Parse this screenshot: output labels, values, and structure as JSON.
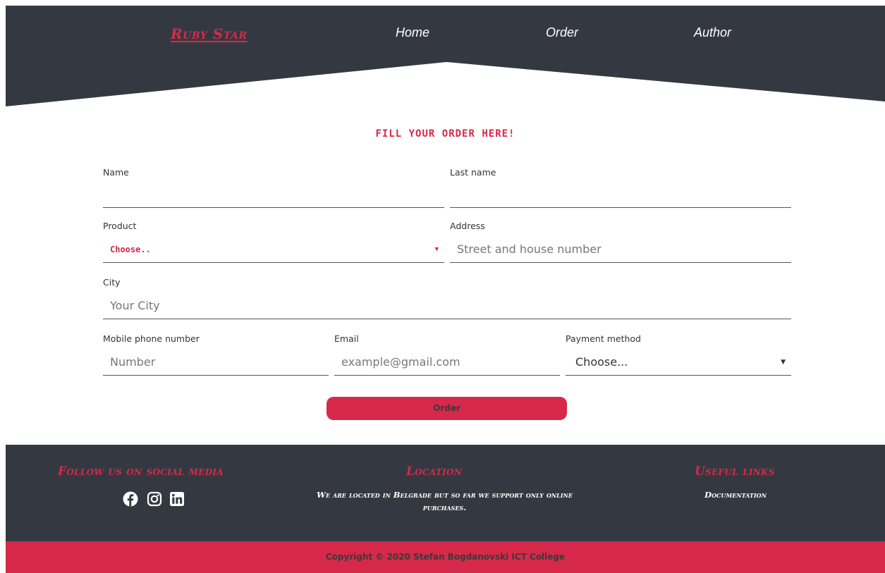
{
  "header": {
    "logo": "Ruby Star",
    "nav": {
      "home": "Home",
      "order": "Order",
      "author": "Author"
    }
  },
  "form": {
    "title": "Fill your order here!",
    "name_label": "Name",
    "last_name_label": "Last name",
    "product_label": "Product",
    "product_selected": "Choose..",
    "address_label": "Address",
    "address_placeholder": "Street and house number",
    "city_label": "City",
    "city_placeholder": "Your City",
    "phone_label": "Mobile phone number",
    "phone_placeholder": "Number",
    "email_label": "Email",
    "email_placeholder": "example@gmail.com",
    "payment_label": "Payment method",
    "payment_selected": "Choose...",
    "submit_label": "Order"
  },
  "footer": {
    "social_heading": "Follow us on social media",
    "location_heading": "Location",
    "location_text": "We are located in Belgrade but so far we support only online purchases.",
    "links_heading": "Useful links",
    "documentation": "Documentation",
    "copyright": "Copyright © 2020 Stefan Bogdanovski ICT College"
  },
  "icons": {
    "facebook": "facebook-icon",
    "instagram": "instagram-icon",
    "linkedin": "linkedin-icon",
    "caret": "caret-down-icon"
  },
  "colors": {
    "accent": "#d6294a",
    "dark": "#343941",
    "white": "#ffffff"
  }
}
